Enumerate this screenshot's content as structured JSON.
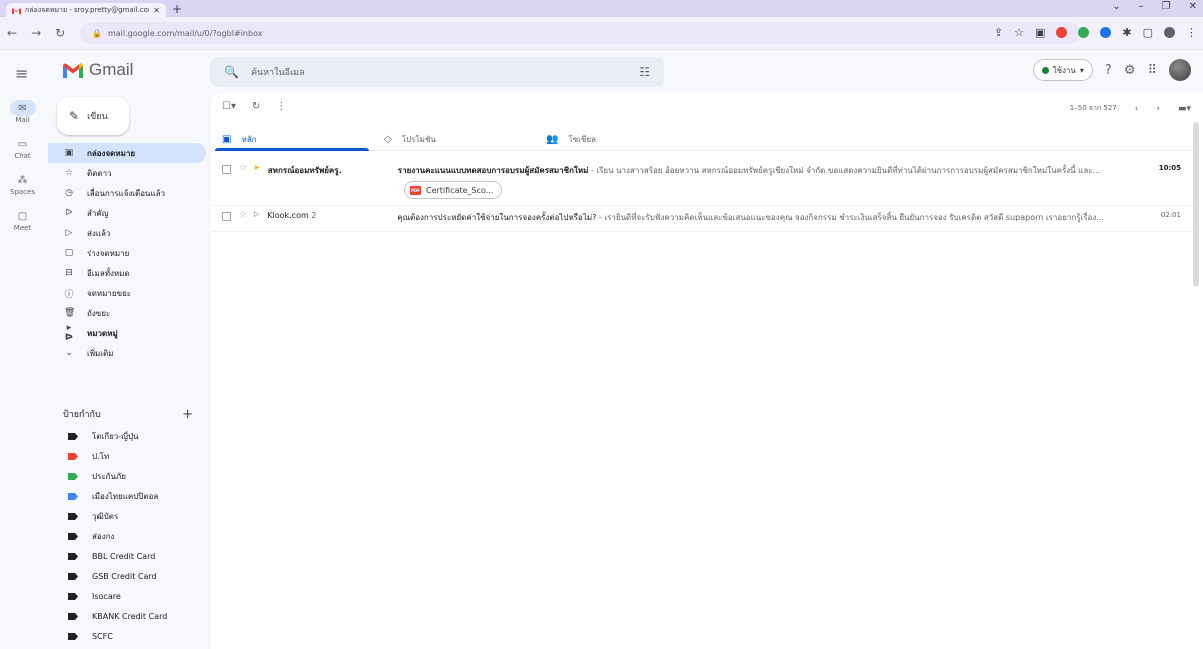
{
  "browser": {
    "tab_title": "กล่องจดหมาย - sroy.pretty@gmail.com",
    "tab_close": "✕",
    "new_tab": "+",
    "url": "mail.google.com/mail/u/0/?ogbl#inbox",
    "window_controls": [
      "⌄",
      "–",
      "❐",
      "✕"
    ]
  },
  "app": {
    "name": "Gmail",
    "search_placeholder": "ค้นหาในอีเมล",
    "status_label": "ใช้งาน",
    "status_color": "#188038"
  },
  "rail": [
    {
      "label": "Mail",
      "icon": "mail-icon"
    },
    {
      "label": "Chat",
      "icon": "chat-icon"
    },
    {
      "label": "Spaces",
      "icon": "spaces-icon"
    },
    {
      "label": "Meet",
      "icon": "meet-icon"
    }
  ],
  "compose_label": "เขียน",
  "nav": [
    {
      "label": "กล่องจดหมาย",
      "icon": "inbox-icon",
      "glyph": "▣"
    },
    {
      "label": "ติดดาว",
      "icon": "star-icon",
      "glyph": "☆"
    },
    {
      "label": "เลื่อนการแจ้งเตือนแล้ว",
      "icon": "snooze-icon",
      "glyph": "◷"
    },
    {
      "label": "สำคัญ",
      "icon": "important-icon",
      "glyph": "ᐅ"
    },
    {
      "label": "ส่งแล้ว",
      "icon": "sent-icon",
      "glyph": "▷"
    },
    {
      "label": "ร่างจดหมาย",
      "icon": "draft-icon",
      "glyph": "▢"
    },
    {
      "label": "อีเมลทั้งหมด",
      "icon": "all-mail-icon",
      "glyph": "⊟"
    },
    {
      "label": "จดหมายขยะ",
      "icon": "spam-icon",
      "glyph": "ⓘ"
    },
    {
      "label": "ถังขยะ",
      "icon": "trash-icon",
      "glyph": "🗑"
    },
    {
      "label": "หมวดหมู่",
      "icon": "categories-icon",
      "glyph": "▸ ᐅ"
    },
    {
      "label": "เพิ่มเติม",
      "icon": "more-icon",
      "glyph": "⌄"
    }
  ],
  "labels_title": "ป้ายกำกับ",
  "labels": [
    {
      "name": "โตเกียว-ญี่ปุ่น",
      "color": "#202124"
    },
    {
      "name": "ป.โท",
      "color": "#ea4335"
    },
    {
      "name": "ประกันภัย",
      "color": "#34a853"
    },
    {
      "name": "เมืองไทยแคปปิตอล",
      "color": "#4285f4"
    },
    {
      "name": "วุฒิบัตร",
      "color": "#202124"
    },
    {
      "name": "ส่องกง",
      "color": "#202124"
    },
    {
      "name": "BBL Credit Card",
      "color": "#202124"
    },
    {
      "name": "GSB Credit Card",
      "color": "#202124"
    },
    {
      "name": "Isocare",
      "color": "#202124"
    },
    {
      "name": "KBANK Credit Card",
      "color": "#202124"
    },
    {
      "name": "SCFC",
      "color": "#202124"
    }
  ],
  "pager": "1–50 จาก 527",
  "tabs": [
    {
      "label": "หลัก",
      "icon": "inbox-tab-icon",
      "glyph": "▣"
    },
    {
      "label": "โปรโมชัน",
      "icon": "tag-icon",
      "glyph": "◇"
    },
    {
      "label": "โซเชียล",
      "icon": "people-icon",
      "glyph": "👥"
    }
  ],
  "emails": [
    {
      "sender": "สหกรณ์ออมทรัพย์ครู.",
      "subject": "รายงานคะแนนแบบทดสอบการอบรมผู้สมัครสมาชิกใหม่",
      "snippet": " - เรียน นางสาวสร้อย อ้อยหวาน สหกรณ์ออมทรัพย์ครูเชียงใหม่ จำกัด ขอแสดงความยินดีที่ท่านได้ผ่านการการอบรมผู้สมัครสมาชิกใหม่ในครั้งนี้ และ...",
      "time": "10:05",
      "attachment": "Certificate_Sco..."
    },
    {
      "sender": "Klook.com",
      "count": "2",
      "subject": "คุณต้องการประหยัดค่าใช้จ่ายในการจองครั้งต่อไปหรือไม่?",
      "snippet": " - เรายินดีที่จะรับฟังความคิดเห็นและข้อเสนอแนะของคุณ จองกิจกรรม ชำระเงินเสร็จสิ้น ยืนยันการจอง รับเครดิต สวัสดี supaporn เราอยากรู้เรื่อง...",
      "time": "02:01"
    }
  ]
}
